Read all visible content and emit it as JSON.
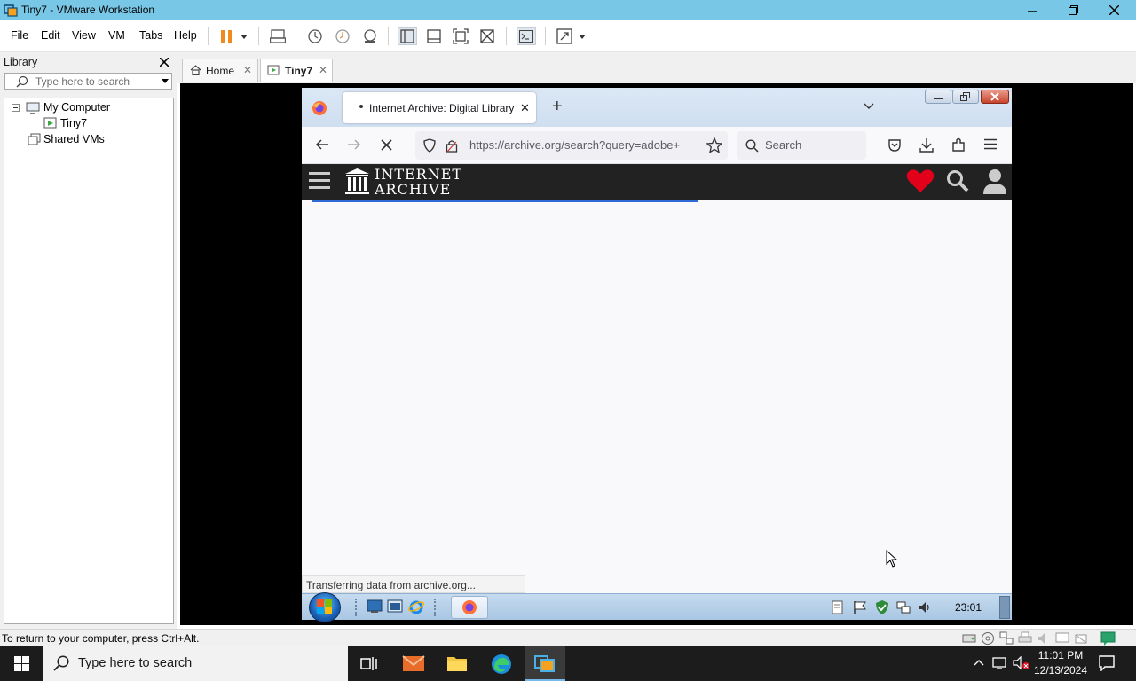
{
  "window": {
    "title": "Tiny7 - VMware Workstation",
    "controls": [
      "minimize",
      "maximize",
      "close"
    ]
  },
  "menu": {
    "items": [
      "File",
      "Edit",
      "View",
      "VM",
      "Tabs",
      "Help"
    ]
  },
  "toolbar": {
    "icons": [
      "pause-icon",
      "dropdown-arrow-icon",
      "send-ctrl-alt-del-icon",
      "snapshot-icon",
      "revert-snapshot-icon",
      "snapshot-manager-icon",
      "show-library-icon",
      "show-thumbnail-bar-icon",
      "full-screen-icon",
      "unity-icon",
      "console-view-icon",
      "stretch-guest-icon",
      "dropdown-arrow-icon"
    ]
  },
  "library": {
    "header": "Library",
    "search_placeholder": "Type here to search",
    "tree": {
      "my_computer": "My Computer",
      "vm": "Tiny7",
      "shared": "Shared VMs"
    }
  },
  "tabs": {
    "home": "Home",
    "vm": "Tiny7"
  },
  "guest": {
    "browser": {
      "tab_title": "Internet Archive: Digital Library",
      "url": "https://archive.org/search?query=adobe+",
      "search_placeholder": "Search",
      "status_text": "Transferring data from archive.org..."
    },
    "site": {
      "logo_line1": "INTERNET",
      "logo_line2": "ARCHIVE"
    },
    "taskbar": {
      "clock": "23:01"
    }
  },
  "status_bar": {
    "text": "To return to your computer, press Ctrl+Alt."
  },
  "host_taskbar": {
    "search_placeholder": "Type here to search",
    "time": "11:01 PM",
    "date": "12/13/2024"
  },
  "colors": {
    "titlebar": "#79c7e6",
    "close_button": "#e81123",
    "ia_header": "#222222",
    "ia_heart": "#e3001b",
    "progress": "#2f6ad6"
  }
}
